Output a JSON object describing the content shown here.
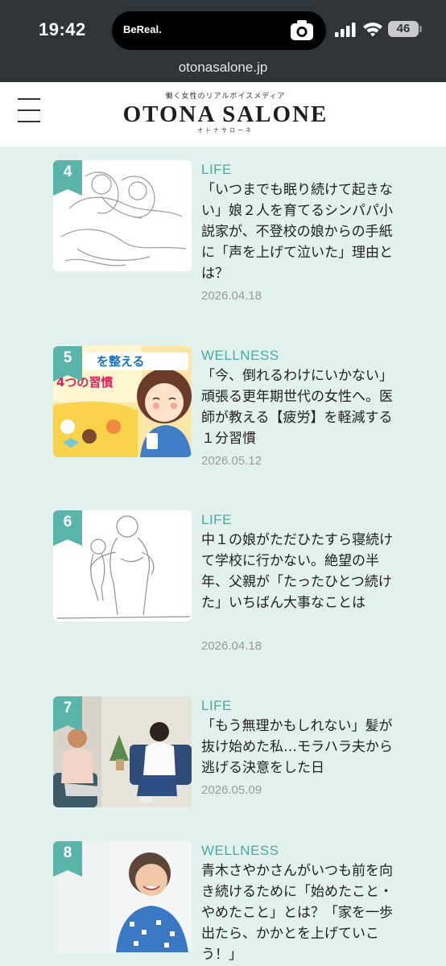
{
  "status_bar": {
    "time": "19:42",
    "island_label": "BeReal.",
    "battery": "46",
    "icons": [
      "camera-icon",
      "signal-icon",
      "wifi-icon",
      "battery-icon"
    ]
  },
  "browser": {
    "url": "otonasalone.jp"
  },
  "site": {
    "tagline": "働く女性のリアルボイスメディア",
    "logo": "OTONA SALONE",
    "logo_kana": "オトナサローネ"
  },
  "articles": [
    {
      "rank": "4",
      "category": "LIFE",
      "title": "「いつまでも眠り続けて起きない」娘２人を育てるシンパパ小説家が、不登校の娘からの手紙に「声を上げて泣いた」理由とは？",
      "date": "2026.04.18"
    },
    {
      "rank": "5",
      "category": "WELLNESS",
      "title": "「今、倒れるわけにいかない」頑張る更年期世代の女性へ。医師が教える【疲労】を軽減する１分習慣",
      "date": "2026.05.12",
      "thumb_text_1": "を整える",
      "thumb_text_2": "4つの習慣"
    },
    {
      "rank": "6",
      "category": "LIFE",
      "title": "中１の娘がただひたすら寝続けて学校に行かない。絶望の半年、父親が「たったひとつ続けた」いちばん大事なことは",
      "date": "2026.04.18"
    },
    {
      "rank": "7",
      "category": "LIFE",
      "title": "「もう無理かもしれない」髪が抜け始めた私…モラハラ夫から逃げる決意をした日",
      "date": "2026.05.09"
    },
    {
      "rank": "8",
      "category": "WELLNESS",
      "title": "青木さやかさんがいつも前を向き続けるために「始めたこと・やめたこと」とは？「家を一歩出たら、かかとを上げていこう！」",
      "date": ""
    }
  ],
  "colors": {
    "accent": "#5ab4a9",
    "category": "#4aa99d",
    "background": "#e3f1ee",
    "statusbar": "#2f3438"
  }
}
